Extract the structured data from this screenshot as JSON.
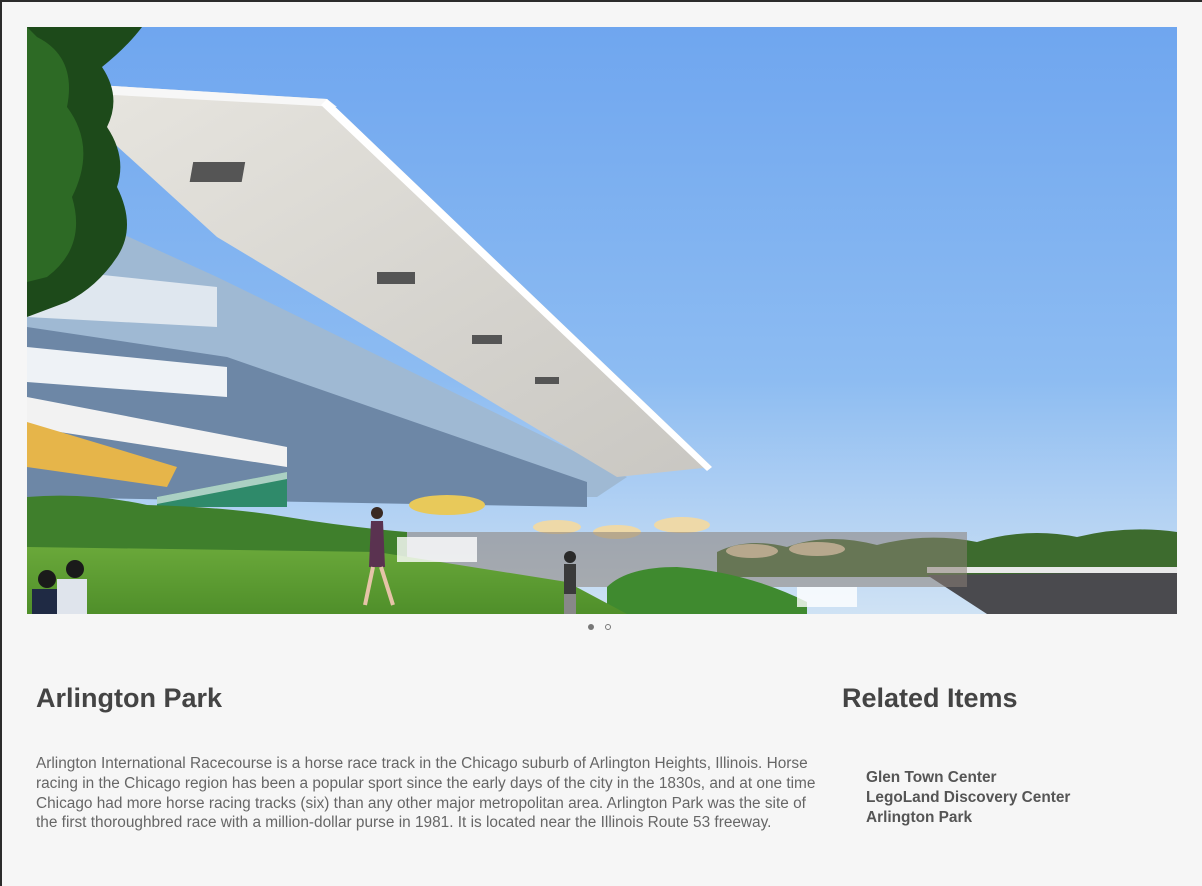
{
  "carousel": {
    "image_alt": "Arlington Park grandstand",
    "dots": [
      {
        "state": "active"
      },
      {
        "state": "inactive"
      }
    ]
  },
  "main": {
    "title": "Arlington Park",
    "description": "Arlington International Racecourse is a horse race track in the Chicago suburb of Arlington Heights, Illinois. Horse racing in the Chicago region has been a popular sport since the early days of the city in the 1830s, and at one time Chicago had more horse racing tracks (six) than any other major metropolitan area. Arlington Park was the site of the first thoroughbred race with a million-dollar purse in 1981. It is located near the Illinois Route 53 freeway."
  },
  "related": {
    "title": "Related Items",
    "items": [
      {
        "label": "Glen Town Center"
      },
      {
        "label": "LegoLand Discovery Center"
      },
      {
        "label": "Arlington Park"
      }
    ]
  },
  "colors": {
    "background": "#f6f6f6",
    "heading": "#444444",
    "body_text": "#666666",
    "sky": "#7fb0ec"
  }
}
